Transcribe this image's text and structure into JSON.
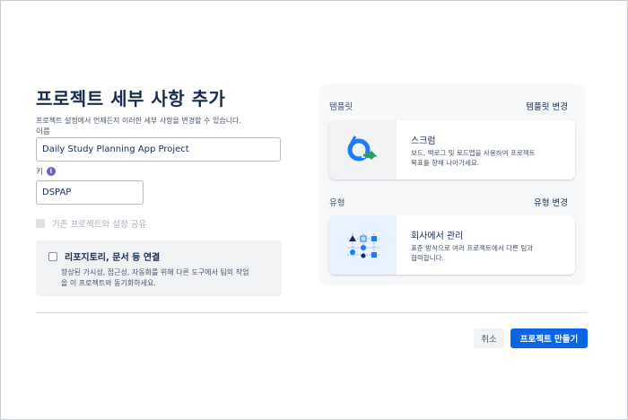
{
  "form": {
    "title": "프로젝트 세부 사항 추가",
    "subtitle": "프로젝트 설정에서 언제든지 이러한 세부 사항을 변경할 수 있습니다.",
    "name_label": "이름",
    "name_value": "Daily Study Planning App Project",
    "key_label": "키",
    "key_value": "DSPAP",
    "share_label": "기존 프로젝트와 설정 공유",
    "connect_title": "리포지토리, 문서 등 연결",
    "connect_desc_1": "향상된 가시성, 접근성, 자동화를 위해 다른 도구에서 팀의 작업",
    "connect_desc_2": "을 이 프로젝트와 동기화하세요."
  },
  "template": {
    "section_label": "템플릿",
    "change_link": "템플릿 변경",
    "card_title": "스크럼",
    "card_desc_1": "보드, 백로그 및 로드맵을 사용하여 프로젝트",
    "card_desc_2": "목표를 향해 나아가세요."
  },
  "type": {
    "section_label": "유형",
    "change_link": "유형 변경",
    "card_title": "회사에서 관리",
    "card_desc_1": "표준 방식으로 여러 프로젝트에서 다른 팀과",
    "card_desc_2": "협력합니다."
  },
  "actions": {
    "cancel_label": "취소",
    "create_label": "프로젝트 만들기"
  },
  "colors": {
    "primary": "#0c66e4",
    "info_icon": "#6e5dc6"
  }
}
